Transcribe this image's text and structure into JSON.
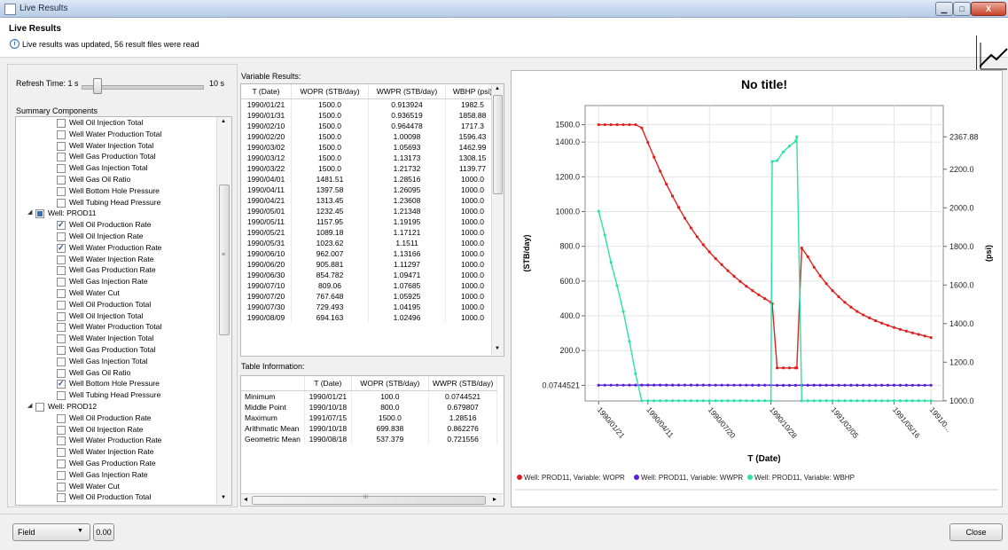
{
  "window": {
    "title": "Live Results",
    "min": "▁",
    "max": "□",
    "close": "X"
  },
  "header": {
    "title": "Live Results",
    "message": "Live results was updated, 56 result files were read",
    "info_icon": "i"
  },
  "refresh": {
    "label": "Refresh Time: 1 s",
    "max_label": "10 s",
    "value_fraction": 0.1
  },
  "summary": {
    "heading": "Summary Components",
    "rows": [
      {
        "label": "Well Oil Injection Total",
        "checked": false,
        "level": 2
      },
      {
        "label": "Well Water Production Total",
        "checked": false,
        "level": 2
      },
      {
        "label": "Well Water Injection Total",
        "checked": false,
        "level": 2
      },
      {
        "label": "Well Gas Production Total",
        "checked": false,
        "level": 2
      },
      {
        "label": "Well Gas Injection Total",
        "checked": false,
        "level": 2
      },
      {
        "label": "Well Gas Oil Ratio",
        "checked": false,
        "level": 2
      },
      {
        "label": "Well Bottom Hole Pressure",
        "checked": false,
        "level": 2
      },
      {
        "label": "Well Tubing Head Pressure",
        "checked": false,
        "level": 2
      },
      {
        "label": "Well: PROD11",
        "checked": "partial",
        "level": 1,
        "expanded": true
      },
      {
        "label": "Well Oil Production Rate",
        "checked": true,
        "level": 2
      },
      {
        "label": "Well Oil Injection Rate",
        "checked": false,
        "level": 2
      },
      {
        "label": "Well Water Production Rate",
        "checked": true,
        "level": 2
      },
      {
        "label": "Well Water Injection Rate",
        "checked": false,
        "level": 2
      },
      {
        "label": "Well Gas Production Rate",
        "checked": false,
        "level": 2
      },
      {
        "label": "Well Gas Injection Rate",
        "checked": false,
        "level": 2
      },
      {
        "label": "Well Water Cut",
        "checked": false,
        "level": 2
      },
      {
        "label": "Well Oil Production Total",
        "checked": false,
        "level": 2
      },
      {
        "label": "Well Oil Injection Total",
        "checked": false,
        "level": 2
      },
      {
        "label": "Well Water Production Total",
        "checked": false,
        "level": 2
      },
      {
        "label": "Well Water Injection Total",
        "checked": false,
        "level": 2
      },
      {
        "label": "Well Gas Production Total",
        "checked": false,
        "level": 2
      },
      {
        "label": "Well Gas Injection Total",
        "checked": false,
        "level": 2
      },
      {
        "label": "Well Gas Oil Ratio",
        "checked": false,
        "level": 2
      },
      {
        "label": "Well Bottom Hole Pressure",
        "checked": true,
        "level": 2
      },
      {
        "label": "Well Tubing Head Pressure",
        "checked": false,
        "level": 2
      },
      {
        "label": "Well: PROD12",
        "checked": false,
        "level": 1,
        "expanded": true
      },
      {
        "label": "Well Oil Production Rate",
        "checked": false,
        "level": 2
      },
      {
        "label": "Well Oil Injection Rate",
        "checked": false,
        "level": 2
      },
      {
        "label": "Well Water Production Rate",
        "checked": false,
        "level": 2
      },
      {
        "label": "Well Water Injection Rate",
        "checked": false,
        "level": 2
      },
      {
        "label": "Well Gas Production Rate",
        "checked": false,
        "level": 2
      },
      {
        "label": "Well Gas Injection Rate",
        "checked": false,
        "level": 2
      },
      {
        "label": "Well Water Cut",
        "checked": false,
        "level": 2
      },
      {
        "label": "Well Oil Production Total",
        "checked": false,
        "level": 2
      }
    ]
  },
  "variable_results": {
    "heading": "Variable Results:",
    "columns": [
      "T (Date)",
      "WOPR (STB/day)",
      "WWPR (STB/day)",
      "WBHP (psi)"
    ],
    "rows": [
      [
        "1990/01/21",
        "1500.0",
        "0.913924",
        "1982.5"
      ],
      [
        "1990/01/31",
        "1500.0",
        "0.936519",
        "1858.88"
      ],
      [
        "1990/02/10",
        "1500.0",
        "0.964478",
        "1717.3"
      ],
      [
        "1990/02/20",
        "1500.0",
        "1.00098",
        "1596.43"
      ],
      [
        "1990/03/02",
        "1500.0",
        "1.05693",
        "1462.99"
      ],
      [
        "1990/03/12",
        "1500.0",
        "1.13173",
        "1308.15"
      ],
      [
        "1990/03/22",
        "1500.0",
        "1.21732",
        "1139.77"
      ],
      [
        "1990/04/01",
        "1481.51",
        "1.28516",
        "1000.0"
      ],
      [
        "1990/04/11",
        "1397.58",
        "1.26095",
        "1000.0"
      ],
      [
        "1990/04/21",
        "1313.45",
        "1.23608",
        "1000.0"
      ],
      [
        "1990/05/01",
        "1232.45",
        "1.21348",
        "1000.0"
      ],
      [
        "1990/05/11",
        "1157.95",
        "1.19195",
        "1000.0"
      ],
      [
        "1990/05/21",
        "1089.18",
        "1.17121",
        "1000.0"
      ],
      [
        "1990/05/31",
        "1023.62",
        "1.1511",
        "1000.0"
      ],
      [
        "1990/06/10",
        "962.007",
        "1.13166",
        "1000.0"
      ],
      [
        "1990/06/20",
        "905.881",
        "1.11297",
        "1000.0"
      ],
      [
        "1990/06/30",
        "854.782",
        "1.09471",
        "1000.0"
      ],
      [
        "1990/07/10",
        "809.06",
        "1.07685",
        "1000.0"
      ],
      [
        "1990/07/20",
        "767.648",
        "1.05925",
        "1000.0"
      ],
      [
        "1990/07/30",
        "729.493",
        "1.04195",
        "1000.0"
      ],
      [
        "1990/08/09",
        "694.163",
        "1.02496",
        "1000.0"
      ]
    ]
  },
  "table_information": {
    "heading": "Table Information:",
    "columns": [
      "",
      "T (Date)",
      "WOPR (STB/day)",
      "WWPR (STB/day)"
    ],
    "rows": [
      [
        "Minimum",
        "1990/01/21",
        "100.0",
        "0.0744521"
      ],
      [
        "Middle Point",
        "1990/10/18",
        "800.0",
        "0.679807"
      ],
      [
        "Maximum",
        "1991/07/15",
        "1500.0",
        "1.28516"
      ],
      [
        "Arithmatic Mean",
        "1990/10/18",
        "699.838",
        "0.862276"
      ],
      [
        "Geometric Mean",
        "1990/08/18",
        "537.379",
        "0.721556"
      ]
    ]
  },
  "chart_data": {
    "type": "line",
    "title": "No title!",
    "xlabel": "T (Date)",
    "ylabel_left": "(STB/day)",
    "ylabel_right": "(psi)",
    "x_ticks": [
      "1990/01/21",
      "1990/04/11",
      "1990/07/20",
      "1990/10/28",
      "1991/02/05",
      "1991/05/16",
      "1991/0..."
    ],
    "x_tick_days": [
      0,
      80,
      180,
      280,
      380,
      480,
      540
    ],
    "x_range_days": [
      -22,
      560
    ],
    "y_left_ticks": [
      "0.0744521",
      "200.0",
      "400.0",
      "600.0",
      "800.0",
      "1000.0",
      "1200.0",
      "1400.0",
      "1500.0"
    ],
    "y_left_tick_values": [
      0.0744521,
      200,
      400,
      600,
      800,
      1000,
      1200,
      1400,
      1500
    ],
    "y_left_range": [
      -90,
      1610
    ],
    "y_right_ticks": [
      "1000.0",
      "1200.0",
      "1400.0",
      "1600.0",
      "1800.0",
      "2000.0",
      "2200.0",
      "2367.88"
    ],
    "y_right_tick_values": [
      1000,
      1200,
      1400,
      1600,
      1800,
      2000,
      2200,
      2367.88
    ],
    "y_right_range": [
      999,
      2530
    ],
    "grid": true,
    "legend_position": "bottom",
    "series": [
      {
        "name": "Well: PROD11, Variable: WOPR",
        "axis": "left",
        "color": "#e02020",
        "x": [
          0,
          10,
          20,
          30,
          40,
          50,
          60,
          70,
          80,
          90,
          100,
          110,
          120,
          130,
          140,
          150,
          160,
          170,
          180,
          190,
          200,
          210,
          220,
          230,
          240,
          250,
          260,
          270,
          280,
          282,
          290,
          300,
          310,
          320,
          322,
          330,
          340,
          350,
          360,
          370,
          380,
          390,
          400,
          410,
          420,
          430,
          440,
          450,
          460,
          470,
          480,
          490,
          500,
          510,
          520,
          530,
          540
        ],
        "y": [
          1500,
          1500,
          1500,
          1500,
          1500,
          1500,
          1500,
          1481.51,
          1397.58,
          1313.45,
          1232.45,
          1157.95,
          1089.18,
          1023.62,
          962.007,
          905.881,
          854.782,
          809.06,
          767.648,
          729.493,
          694.163,
          660,
          628,
          598,
          570,
          545,
          521,
          499,
          478,
          470,
          100,
          100,
          100,
          100,
          100,
          790,
          740,
          680,
          630,
          585,
          545,
          510,
          478,
          450,
          425,
          405,
          388,
          372,
          358,
          345,
          333,
          322,
          312,
          302,
          293,
          284,
          275
        ]
      },
      {
        "name": "Well: PROD11, Variable: WWPR",
        "axis": "left",
        "color": "#5a1fd8",
        "x": [
          0,
          10,
          20,
          30,
          40,
          50,
          60,
          70,
          80,
          90,
          100,
          110,
          120,
          130,
          140,
          150,
          160,
          170,
          180,
          190,
          200,
          210,
          220,
          230,
          240,
          250,
          260,
          270,
          280,
          290,
          300,
          310,
          320,
          330,
          340,
          350,
          360,
          370,
          380,
          390,
          400,
          410,
          420,
          430,
          440,
          450,
          460,
          470,
          480,
          490,
          500,
          510,
          520,
          530,
          540
        ],
        "y": [
          0.913924,
          0.936519,
          0.964478,
          1.00098,
          1.05693,
          1.13173,
          1.21732,
          1.28516,
          1.26095,
          1.23608,
          1.21348,
          1.19195,
          1.17121,
          1.1511,
          1.13166,
          1.11297,
          1.09471,
          1.07685,
          1.05925,
          1.04195,
          1.02496,
          1.01,
          0.99,
          0.97,
          0.95,
          0.93,
          0.91,
          0.89,
          0.87,
          0.1,
          0.0744521,
          0.08,
          0.09,
          0.6,
          0.59,
          0.58,
          0.57,
          0.56,
          0.55,
          0.54,
          0.53,
          0.52,
          0.51,
          0.5,
          0.49,
          0.48,
          0.47,
          0.46,
          0.45,
          0.44,
          0.43,
          0.42,
          0.41,
          0.4,
          0.39
        ]
      },
      {
        "name": "Well: PROD11, Variable: WBHP",
        "axis": "right",
        "color": "#2fe0a8",
        "x": [
          0,
          10,
          20,
          30,
          40,
          50,
          60,
          70,
          80,
          90,
          100,
          110,
          120,
          130,
          140,
          150,
          160,
          170,
          180,
          190,
          200,
          210,
          220,
          230,
          240,
          250,
          260,
          270,
          280,
          282,
          290,
          300,
          310,
          320,
          322,
          330,
          340,
          350,
          360,
          370,
          380,
          390,
          400,
          410,
          420,
          430,
          440,
          450,
          460,
          470,
          480,
          490,
          500,
          510,
          520,
          530,
          540
        ],
        "y": [
          1982.5,
          1858.88,
          1717.3,
          1596.43,
          1462.99,
          1308.15,
          1139.77,
          1000,
          1000,
          1000,
          1000,
          1000,
          1000,
          1000,
          1000,
          1000,
          1000,
          1000,
          1000,
          1000,
          1000,
          1000,
          1000,
          1000,
          1000,
          1000,
          1000,
          1000,
          1000,
          2240,
          2245,
          2290,
          2320,
          2345,
          2367.88,
          1000,
          1000,
          1000,
          1000,
          1000,
          1000,
          1000,
          1000,
          1000,
          1000,
          1000,
          1000,
          1000,
          1000,
          1000,
          1000,
          1000,
          1000,
          1000,
          1000,
          1000,
          1000
        ]
      }
    ]
  },
  "bottom": {
    "field_select": "Field",
    "field_value": "0.00",
    "close": "Close"
  },
  "scroll": {
    "arrow_up": "▲",
    "arrow_down": "▼",
    "arrow_left": "◂",
    "arrow_right": "▸",
    "grip": "≡",
    "hgrip": "III"
  }
}
